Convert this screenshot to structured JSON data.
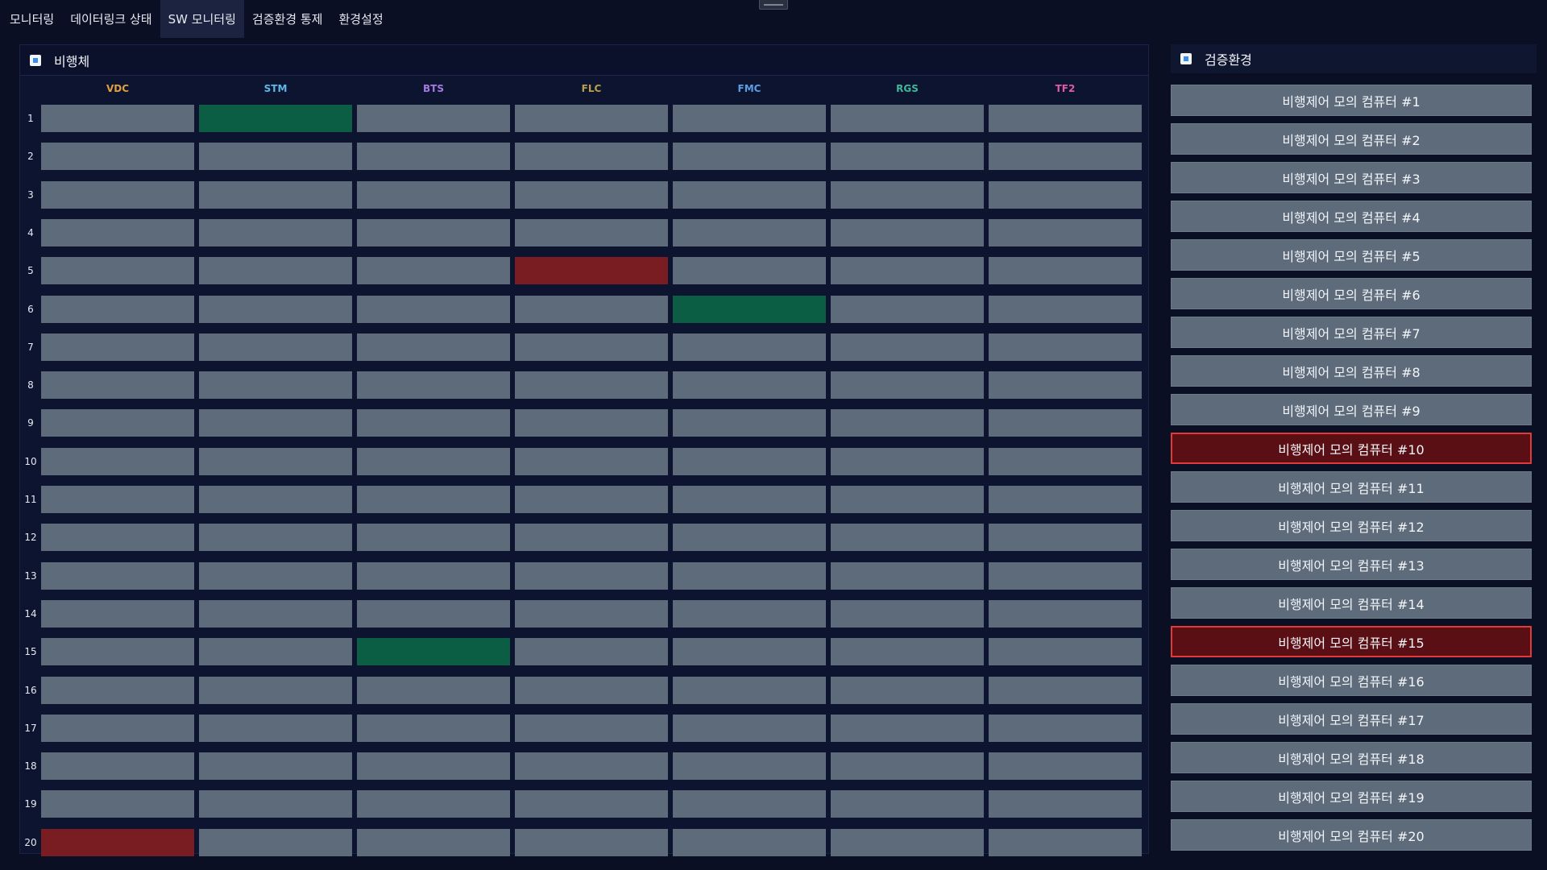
{
  "nav": {
    "tabs": [
      {
        "label": "모니터링",
        "active": false
      },
      {
        "label": "데이터링크 상태",
        "active": false
      },
      {
        "label": "SW 모니터링",
        "active": true
      },
      {
        "label": "검증환경 통제",
        "active": false
      },
      {
        "label": "환경설정",
        "active": false
      }
    ]
  },
  "left_panel": {
    "title": "비행체",
    "columns": [
      {
        "label": "VDC",
        "color": "#e0a042"
      },
      {
        "label": "STM",
        "color": "#5fb8e8"
      },
      {
        "label": "BTS",
        "color": "#a47ae0"
      },
      {
        "label": "FLC",
        "color": "#b8a04a"
      },
      {
        "label": "FMC",
        "color": "#5a9ee6"
      },
      {
        "label": "RGS",
        "color": "#3fb89a"
      },
      {
        "label": "TF2",
        "color": "#e05aa8"
      }
    ],
    "rows": [
      "1",
      "2",
      "3",
      "4",
      "5",
      "6",
      "7",
      "8",
      "9",
      "10",
      "11",
      "12",
      "13",
      "14",
      "15",
      "16",
      "17",
      "18",
      "19",
      "20"
    ],
    "cell_states": [
      [
        "gray",
        "green",
        "gray",
        "gray",
        "gray",
        "gray",
        "gray"
      ],
      [
        "gray",
        "gray",
        "gray",
        "gray",
        "gray",
        "gray",
        "gray"
      ],
      [
        "gray",
        "gray",
        "gray",
        "gray",
        "gray",
        "gray",
        "gray"
      ],
      [
        "gray",
        "gray",
        "gray",
        "gray",
        "gray",
        "gray",
        "gray"
      ],
      [
        "gray",
        "gray",
        "gray",
        "red",
        "gray",
        "gray",
        "gray"
      ],
      [
        "gray",
        "gray",
        "gray",
        "gray",
        "green",
        "gray",
        "gray"
      ],
      [
        "gray",
        "gray",
        "gray",
        "gray",
        "gray",
        "gray",
        "gray"
      ],
      [
        "gray",
        "gray",
        "gray",
        "gray",
        "gray",
        "gray",
        "gray"
      ],
      [
        "gray",
        "gray",
        "gray",
        "gray",
        "gray",
        "gray",
        "gray"
      ],
      [
        "gray",
        "gray",
        "gray",
        "gray",
        "gray",
        "gray",
        "gray"
      ],
      [
        "gray",
        "gray",
        "gray",
        "gray",
        "gray",
        "gray",
        "gray"
      ],
      [
        "gray",
        "gray",
        "gray",
        "gray",
        "gray",
        "gray",
        "gray"
      ],
      [
        "gray",
        "gray",
        "gray",
        "gray",
        "gray",
        "gray",
        "gray"
      ],
      [
        "gray",
        "gray",
        "gray",
        "gray",
        "gray",
        "gray",
        "gray"
      ],
      [
        "gray",
        "gray",
        "green",
        "gray",
        "gray",
        "gray",
        "gray"
      ],
      [
        "gray",
        "gray",
        "gray",
        "gray",
        "gray",
        "gray",
        "gray"
      ],
      [
        "gray",
        "gray",
        "gray",
        "gray",
        "gray",
        "gray",
        "gray"
      ],
      [
        "gray",
        "gray",
        "gray",
        "gray",
        "gray",
        "gray",
        "gray"
      ],
      [
        "gray",
        "gray",
        "gray",
        "gray",
        "gray",
        "gray",
        "gray"
      ],
      [
        "red",
        "gray",
        "gray",
        "gray",
        "gray",
        "gray",
        "gray"
      ]
    ]
  },
  "right_panel": {
    "title": "검증환경",
    "items": [
      {
        "label": "비행제어 모의 컴퓨터 #1",
        "alert": false
      },
      {
        "label": "비행제어 모의 컴퓨터 #2",
        "alert": false
      },
      {
        "label": "비행제어 모의 컴퓨터 #3",
        "alert": false
      },
      {
        "label": "비행제어 모의 컴퓨터 #4",
        "alert": false
      },
      {
        "label": "비행제어 모의 컴퓨터 #5",
        "alert": false
      },
      {
        "label": "비행제어 모의 컴퓨터 #6",
        "alert": false
      },
      {
        "label": "비행제어 모의 컴퓨터 #7",
        "alert": false
      },
      {
        "label": "비행제어 모의 컴퓨터 #8",
        "alert": false
      },
      {
        "label": "비행제어 모의 컴퓨터 #9",
        "alert": false
      },
      {
        "label": "비행제어 모의 컴퓨터 #10",
        "alert": true
      },
      {
        "label": "비행제어 모의 컴퓨터 #11",
        "alert": false
      },
      {
        "label": "비행제어 모의 컴퓨터 #12",
        "alert": false
      },
      {
        "label": "비행제어 모의 컴퓨터 #13",
        "alert": false
      },
      {
        "label": "비행제어 모의 컴퓨터 #14",
        "alert": false
      },
      {
        "label": "비행제어 모의 컴퓨터 #15",
        "alert": true
      },
      {
        "label": "비행제어 모의 컴퓨터 #16",
        "alert": false
      },
      {
        "label": "비행제어 모의 컴퓨터 #17",
        "alert": false
      },
      {
        "label": "비행제어 모의 컴퓨터 #18",
        "alert": false
      },
      {
        "label": "비행제어 모의 컴퓨터 #19",
        "alert": false
      },
      {
        "label": "비행제어 모의 컴퓨터 #20",
        "alert": false
      }
    ]
  }
}
